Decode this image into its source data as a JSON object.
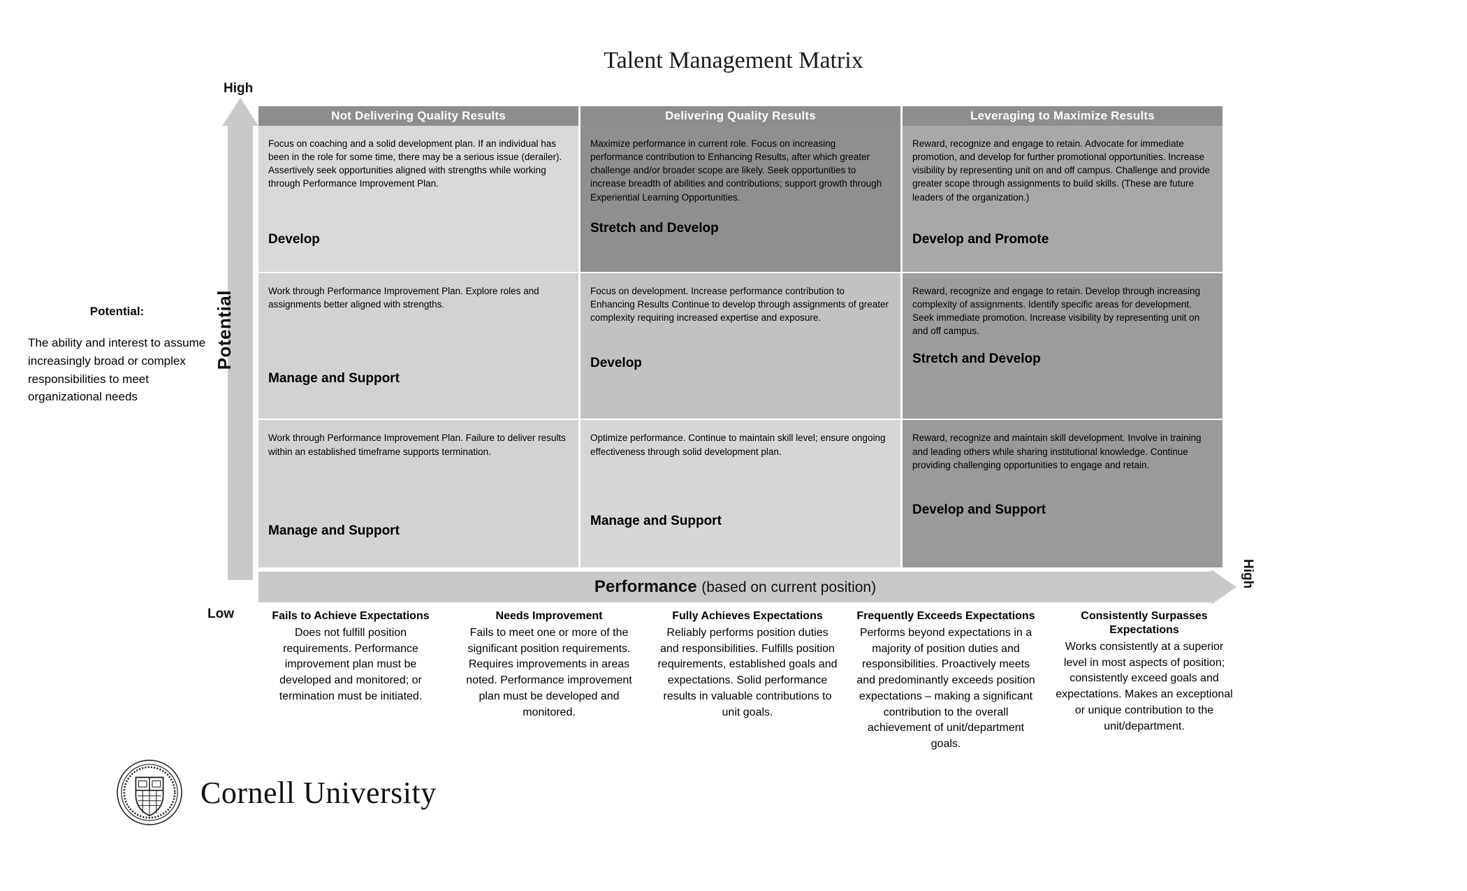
{
  "title": "Talent Management Matrix",
  "axes": {
    "y_title": "Potential",
    "y_high": "High",
    "y_low": "Low",
    "x_title_bold": "Performance",
    "x_title_sub": "(based on current position)",
    "x_high": "High"
  },
  "potential_definition": {
    "heading": "Potential:",
    "body": "The ability and interest to assume increasingly broad or complex responsibilities to meet organizational needs"
  },
  "column_headers": [
    "Not Delivering Quality Results",
    "Delivering Quality Results",
    "Leveraging to Maximize Results"
  ],
  "cells": [
    [
      {
        "description": "Focus on coaching and a solid development plan. If an individual has been in the role for some time, there may be a serious issue (derailer).  Assertively seek opportunities aligned with strengths while working through Performance Improvement Plan.",
        "action": "Develop"
      },
      {
        "description": "Maximize performance in current role. Focus on increasing performance contribution to Enhancing Results, after which greater challenge and/or broader scope are likely. Seek opportunities to increase breadth of abilities and contributions; support growth through Experiential Learning Opportunities.",
        "action": "Stretch and Develop"
      },
      {
        "description": "Reward, recognize and engage to retain. Advocate for immediate promotion, and develop for further promotional opportunities. Increase visibility by representing unit on and off campus. Challenge and provide greater scope through assignments to build skills. (These are future leaders of the organization.)",
        "action": "Develop and Promote"
      }
    ],
    [
      {
        "description": "Work through Performance Improvement Plan. Explore roles and assignments better aligned with strengths.",
        "action": "Manage and Support"
      },
      {
        "description": "Focus on development. Increase performance contribution to Enhancing Results Continue to develop through assignments of greater complexity requiring increased expertise and exposure.",
        "action": "Develop"
      },
      {
        "description": "Reward, recognize and engage to retain. Develop through increasing complexity of assignments.  Identify specific areas for development. Seek immediate promotion. Increase visibility by representing unit on and off campus.",
        "action": "Stretch and Develop"
      }
    ],
    [
      {
        "description": "Work through Performance Improvement Plan. Failure to deliver results within an established timeframe supports termination.",
        "action": "Manage and Support"
      },
      {
        "description": "Optimize performance. Continue to maintain skill level; ensure ongoing effectiveness through solid development plan.",
        "action": "Manage and Support"
      },
      {
        "description": "Reward, recognize and maintain skill development. Involve in training and leading others while sharing institutional knowledge. Continue providing challenging opportunities to engage and retain.",
        "action": "Develop and Support"
      }
    ]
  ],
  "ratings": [
    {
      "title": "Fails to Achieve Expectations",
      "description": "Does not fulfill position requirements. Performance improvement plan must be developed and monitored; or termination must be initiated."
    },
    {
      "title": "Needs Improvement",
      "description": "Fails to meet one or more of the significant position requirements. Requires improvements in areas noted. Performance improvement plan must be developed and monitored."
    },
    {
      "title": "Fully Achieves Expectations",
      "description": "Reliably performs position duties and responsibilities. Fulfills position requirements, established goals and expectations. Solid performance results in valuable contributions to unit goals."
    },
    {
      "title": "Frequently Exceeds Expectations",
      "description": "Performs beyond expectations in a majority of position duties and responsibilities. Proactively meets and predominantly exceeds position expectations – making a significant contribution to the overall achievement of unit/department goals."
    },
    {
      "title": "Consistently Surpasses Expectations",
      "description": "Works consistently at a superior level in most aspects of position; consistently exceed goals and expectations. Makes an exceptional or unique contribution to the unit/department."
    }
  ],
  "footer": {
    "wordmark": "Cornell University"
  }
}
